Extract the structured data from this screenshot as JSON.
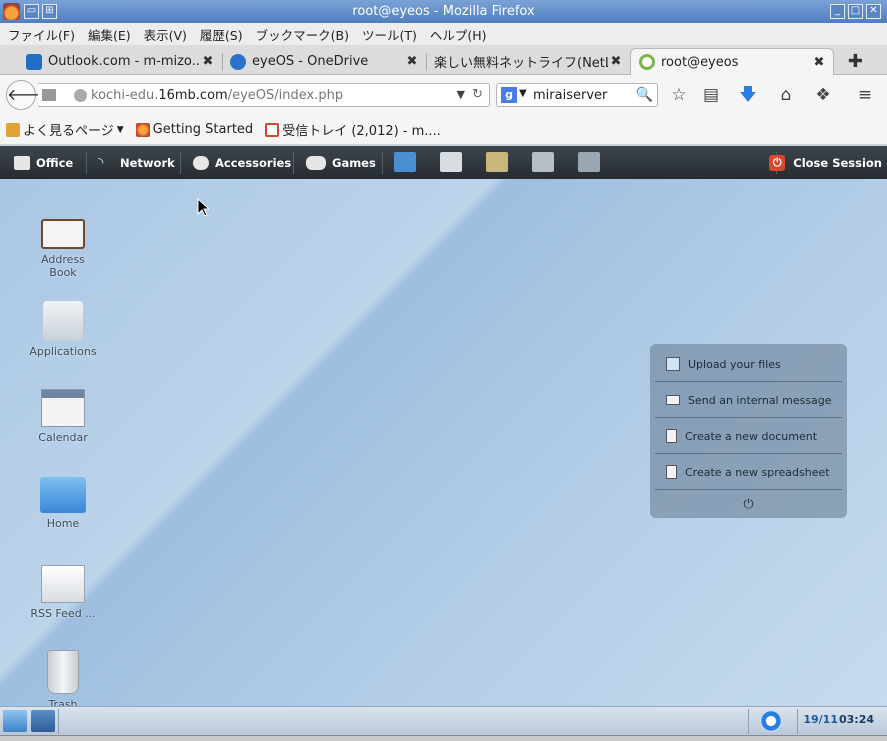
{
  "window": {
    "title": "root@eyeos - Mozilla Firefox"
  },
  "menubar": {
    "items": [
      "ファイル(F)",
      "編集(E)",
      "表示(V)",
      "履歴(S)",
      "ブックマーク(B)",
      "ツール(T)",
      "ヘルプ(H)"
    ]
  },
  "tabs": [
    {
      "label": "Outlook.com - m-mizo...",
      "icon": "outlook-icon",
      "color": "#1e6ec1"
    },
    {
      "label": "eyeOS - OneDrive",
      "icon": "onedrive-icon",
      "color": "#2a73c9"
    },
    {
      "label": "楽しい無料ネットライフ(NetLi...",
      "icon": "",
      "color": ""
    },
    {
      "label": "root@eyeos",
      "icon": "eyeos-icon",
      "color": "#7ab648"
    }
  ],
  "navbar": {
    "url_prefix": "kochi-edu.",
    "url_domain": "16mb.com",
    "url_path": "/eyeOS/index.php",
    "search_value": "miraiserver"
  },
  "bookmarks": [
    {
      "label": "よく見るページ",
      "icon": "folder-icon",
      "has_dropdown": true
    },
    {
      "label": "Getting Started",
      "icon": "firefox-icon"
    },
    {
      "label": "受信トレイ (2,012) - m....",
      "icon": "gmail-icon"
    }
  ],
  "eyebar": {
    "menus": [
      {
        "label": "Office",
        "icon": "briefcase-icon"
      },
      {
        "label": "Network",
        "icon": "wifi-icon"
      },
      {
        "label": "Accessories",
        "icon": "accessories-icon"
      },
      {
        "label": "Games",
        "icon": "gamepad-icon"
      }
    ],
    "apps": [
      "files-app-icon",
      "documents-app-icon",
      "image-app-icon",
      "contacts-app-icon",
      "calendar-app-icon"
    ],
    "close_session": "Close Session"
  },
  "desktop": {
    "icons": [
      {
        "label": "Address Book",
        "name": "address-book-icon"
      },
      {
        "label": "Applications",
        "name": "applications-icon"
      },
      {
        "label": "Calendar",
        "name": "calendar-icon"
      },
      {
        "label": "Home",
        "name": "home-folder-icon"
      },
      {
        "label": "RSS Feed ...",
        "name": "rss-feed-icon"
      },
      {
        "label": "Trash",
        "name": "trash-icon"
      }
    ]
  },
  "quick_panel": {
    "items": [
      {
        "label": "Upload your files",
        "icon": "upload-icon"
      },
      {
        "label": "Send an internal message",
        "icon": "mail-icon"
      },
      {
        "label": "Create a new document",
        "icon": "document-icon"
      },
      {
        "label": "Create a new spreadsheet",
        "icon": "spreadsheet-icon"
      }
    ],
    "power_icon": "power-icon"
  },
  "taskbar": {
    "date": "19/11",
    "time": "03:24"
  }
}
